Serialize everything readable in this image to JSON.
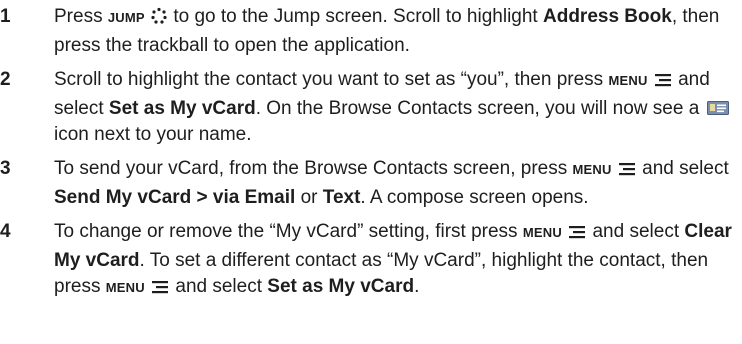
{
  "steps": [
    {
      "number": "1",
      "parts": {
        "a": "Press ",
        "key_jump": "JUMP",
        "b": " to go to the Jump screen. Scroll to highlight ",
        "bold_address_book": "Address Book",
        "c": ", then press the trackball to open the application."
      },
      "icons": [
        "jump-icon"
      ]
    },
    {
      "number": "2",
      "parts": {
        "a": "Scroll to highlight the contact you want to set as “you”, then press ",
        "key_menu": "MENU",
        "b": " and select ",
        "bold_set": "Set as My vCard",
        "c": ". On the Browse Contacts screen, you will now see a ",
        "d": " icon next to your name."
      },
      "icons": [
        "menu-icon",
        "vcard-icon"
      ]
    },
    {
      "number": "3",
      "parts": {
        "a": "To send your vCard, from the Browse Contacts screen, press ",
        "key_menu": "MENU",
        "b": " and select ",
        "bold_send": "Send My vCard > via Email",
        "c": " or ",
        "bold_text": "Text",
        "d": ". A compose screen opens."
      },
      "icons": [
        "menu-icon"
      ]
    },
    {
      "number": "4",
      "parts": {
        "a": "To change or remove the “My vCard” setting, first press ",
        "key_menu_1": "MENU",
        "b": " and select ",
        "bold_clear": "Clear My vCard",
        "c": ". To set a different contact as “My vCard”, highlight the contact, then press ",
        "key_menu_2": "MENU",
        "d": " and select ",
        "bold_set": "Set as My vCard",
        "e": "."
      },
      "icons": [
        "menu-icon"
      ]
    }
  ],
  "colors": {
    "text": "#1e1e1e",
    "vcard_icon_fill": "#7a8fb0"
  }
}
